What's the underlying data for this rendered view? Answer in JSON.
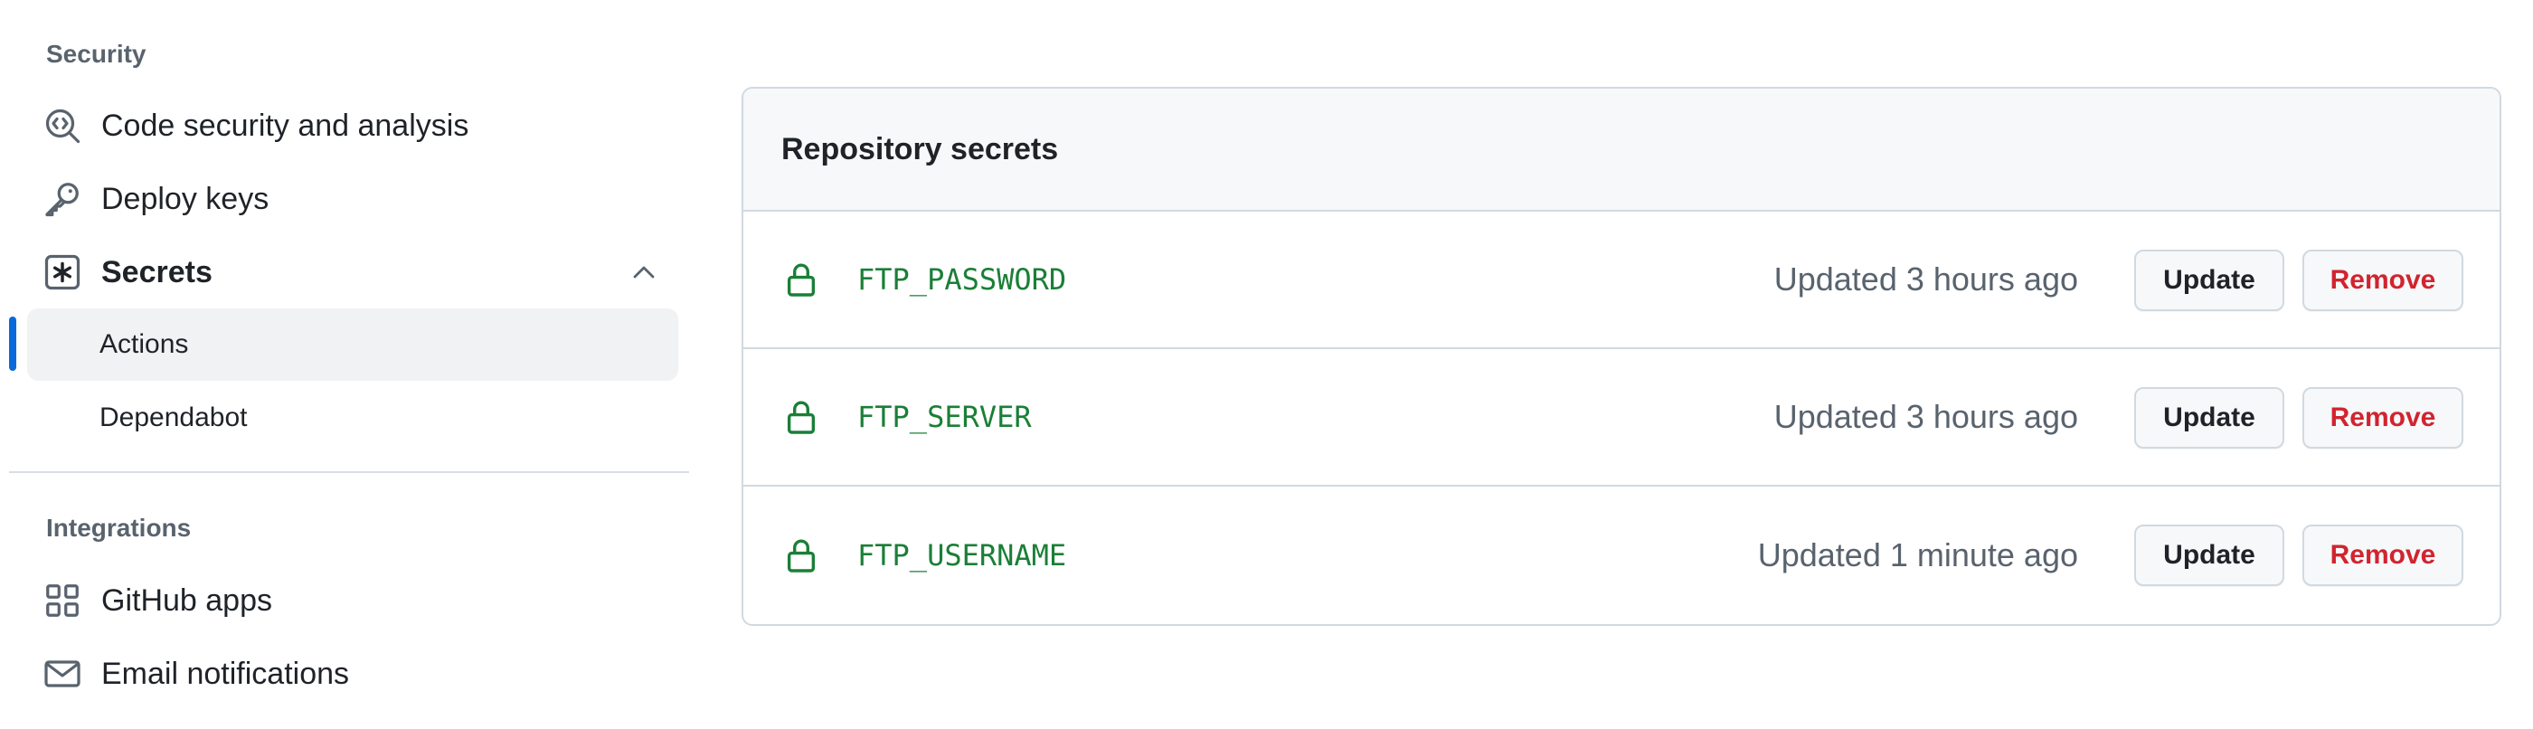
{
  "sidebar": {
    "security_heading": "Security",
    "integrations_heading": "Integrations",
    "items": {
      "code_security": {
        "label": "Code security and analysis",
        "icon": "codescan-icon"
      },
      "deploy_keys": {
        "label": "Deploy keys",
        "icon": "key-icon"
      },
      "secrets": {
        "label": "Secrets",
        "icon": "asterisk-icon",
        "expanded": true
      },
      "actions": {
        "label": "Actions",
        "active": true
      },
      "dependabot": {
        "label": "Dependabot"
      },
      "github_apps": {
        "label": "GitHub apps",
        "icon": "apps-icon"
      },
      "email_notifications": {
        "label": "Email notifications",
        "icon": "mail-icon"
      }
    }
  },
  "panel": {
    "title": "Repository secrets",
    "secrets": [
      {
        "name": "FTP_PASSWORD",
        "updated": "Updated 3 hours ago",
        "update_label": "Update",
        "remove_label": "Remove"
      },
      {
        "name": "FTP_SERVER",
        "updated": "Updated 3 hours ago",
        "update_label": "Update",
        "remove_label": "Remove"
      },
      {
        "name": "FTP_USERNAME",
        "updated": "Updated 1 minute ago",
        "update_label": "Update",
        "remove_label": "Remove"
      }
    ]
  },
  "colors": {
    "accent": "#0969da",
    "secret_name": "#1a7f37",
    "danger": "#d1242f",
    "muted": "#59636e"
  }
}
